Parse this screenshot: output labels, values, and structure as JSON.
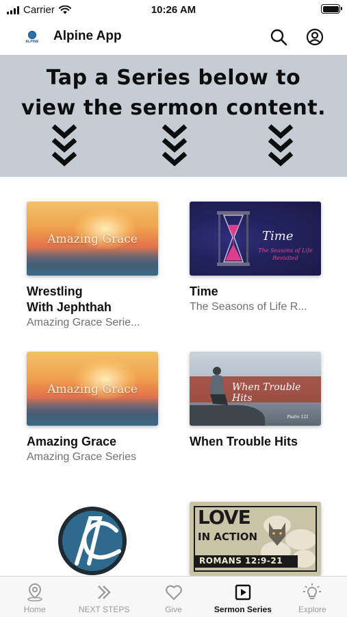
{
  "status_bar": {
    "carrier": "Carrier",
    "time": "10:26 AM"
  },
  "header": {
    "logo_text": "ALPINE",
    "title": "Alpine App",
    "icons": [
      "search-icon",
      "account-icon"
    ]
  },
  "banner": {
    "line1": "Tap a Series below to",
    "line2": "view the sermon content.",
    "background_color": "#c5ccd3"
  },
  "series": [
    {
      "title_line1": "Wrestling",
      "title_line2": "With Jephthah",
      "subtitle": "Amazing Grace Serie...",
      "thumbnail_label": "Amazing Grace"
    },
    {
      "title_line1": "Time",
      "title_line2": "",
      "subtitle": "The Seasons of Life R...",
      "thumbnail_label": "Time",
      "thumbnail_sublabel": "The Seasons of Life Revisited"
    },
    {
      "title_line1": "Amazing Grace",
      "title_line2": "",
      "subtitle": "Amazing Grace Series",
      "thumbnail_label": "Amazing Grace"
    },
    {
      "title_line1": "When Trouble Hits",
      "title_line2": "",
      "subtitle": "",
      "thumbnail_label": "When Trouble Hits",
      "thumbnail_sublabel": "Psalm 121"
    },
    {
      "title_line1": "",
      "title_line2": "",
      "subtitle": "",
      "thumbnail_label": "AC"
    },
    {
      "title_line1": "",
      "title_line2": "",
      "subtitle": "",
      "thumbnail_label": "LOVE",
      "thumbnail_sublabel": "IN ACTION",
      "thumbnail_verse": "ROMANS 12:9-21"
    }
  ],
  "tab_bar": {
    "tabs": [
      {
        "label": "Home",
        "icon": "location-pin-icon",
        "active": false
      },
      {
        "label": "NEXT STEPS",
        "icon": "double-chevron-right-icon",
        "active": false
      },
      {
        "label": "Give",
        "icon": "heart-icon",
        "active": false
      },
      {
        "label": "Sermon Series",
        "icon": "play-square-icon",
        "active": true
      },
      {
        "label": "Explore",
        "icon": "lightbulb-icon",
        "active": false
      }
    ]
  },
  "colors": {
    "accent": "#111111",
    "inactive_tab": "#9a9a9a",
    "subtitle_gray": "#707070",
    "love_pink": "#e6448f"
  }
}
